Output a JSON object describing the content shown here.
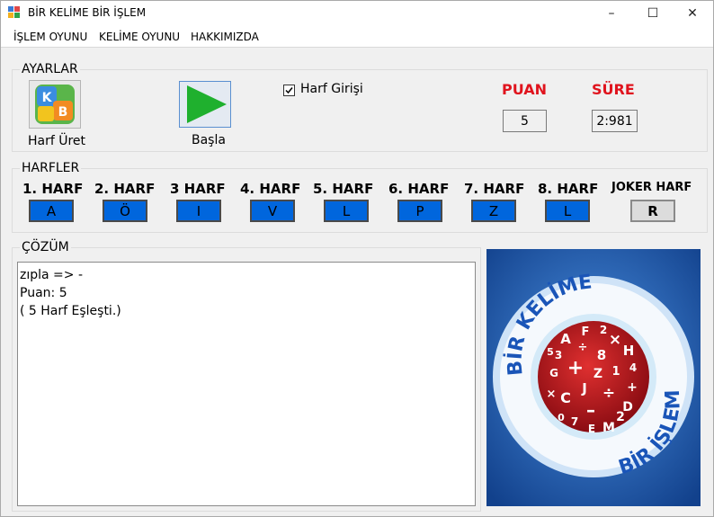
{
  "window": {
    "title": "BİR KELİME BİR İŞLEM",
    "controls": {
      "minimize": "–",
      "maximize": "☐",
      "close": "✕"
    }
  },
  "menu": [
    "İŞLEM OYUNU",
    "KELİME OYUNU",
    "HAKKIMIZDA"
  ],
  "settings": {
    "group_title": "AYARLAR",
    "generate_label": "Harf Üret",
    "start_label": "Başla",
    "letter_input_label": "Harf Girişi",
    "letter_input_checked": true,
    "score_title": "PUAN",
    "score_value": "5",
    "time_title": "SÜRE",
    "time_value": "2:981",
    "icon_letters": [
      "K",
      "B"
    ]
  },
  "letters": {
    "group_title": "HARFLER",
    "labels": [
      "1. HARF",
      "2. HARF",
      "3 HARF",
      "4. HARF",
      "5. HARF",
      "6. HARF",
      "7. HARF",
      "8. HARF"
    ],
    "values": [
      "A",
      "Ö",
      "I",
      "V",
      "L",
      "P",
      "Z",
      "L"
    ],
    "joker_label": "JOKER HARF",
    "joker_value": "R"
  },
  "solution": {
    "group_title": "ÇÖZÜM",
    "lines": [
      "zıpla => -",
      "Puan: 5",
      "( 5 Harf Eşleşti.)"
    ]
  },
  "logo": {
    "top_text": "BİR KELİME",
    "bottom_text": "BİR İŞLEM",
    "glyphs": [
      "A",
      "F",
      "2",
      "×",
      "3",
      "÷",
      "5",
      "H",
      "+",
      "8",
      "G",
      "Z",
      "1",
      "4",
      "×",
      "C",
      "J",
      "÷",
      "+",
      "D",
      "–",
      "0",
      "7",
      "E",
      "M",
      "2"
    ]
  },
  "colors": {
    "accent_red": "#e0141e",
    "letter_blue": "#0066dd",
    "play_green": "#1fb02e"
  }
}
